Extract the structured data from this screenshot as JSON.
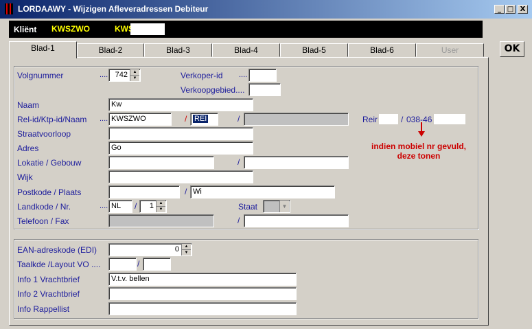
{
  "window": {
    "title": "LORDAAWY - Wijzigen Afleveradressen Debiteur",
    "minimize": "_",
    "maximize": "□",
    "close": "X"
  },
  "client": {
    "label": "Kliënt",
    "code": "KWSZWO",
    "name": "KWS"
  },
  "tabs": [
    "Blad-1",
    "Blad-2",
    "Blad-3",
    "Blad-4",
    "Blad-5",
    "Blad-6",
    "User"
  ],
  "ok_label": "OK",
  "form": {
    "volgnummer": {
      "label": "Volgnummer",
      "dots": "....",
      "value": "742"
    },
    "verkoper": {
      "label": "Verkoper-id",
      "dots": "....",
      "value": ""
    },
    "verkoopgebied": {
      "label": "Verkoopgebied....",
      "value": ""
    },
    "naam": {
      "label": "Naam",
      "value": "Kw"
    },
    "relid": {
      "label": "Rel-id/Ktp-id/Naam",
      "dots": "....",
      "rel": "KWSZWO",
      "slash1": "/",
      "ktp": "REI",
      "slash2": "/",
      "naam": ""
    },
    "side_contact": {
      "name": "Reir",
      "sep": "/",
      "phone": "038-46"
    },
    "straat": {
      "label": "Straatvoorloop",
      "value": ""
    },
    "adres": {
      "label": "Adres",
      "value": "Go"
    },
    "lokatie": {
      "label": "Lokatie / Gebouw",
      "value": "",
      "slash": "/",
      "value2": ""
    },
    "wijk": {
      "label": "Wijk",
      "value": ""
    },
    "postkode": {
      "label": "Postkode / Plaats",
      "value": "",
      "slash": "/",
      "plaats": "Wi"
    },
    "landkode": {
      "label": "Landkode  / Nr.",
      "dots": "....",
      "land": "NL",
      "slash": "/",
      "nr": "1"
    },
    "staat": {
      "label": "Staat",
      "value": ""
    },
    "telefoon": {
      "label": "Telefoon / Fax",
      "value": "",
      "slash": "/",
      "fax": ""
    },
    "note": [
      "indien mobiel nr gevuld,",
      "deze tonen"
    ]
  },
  "form2": {
    "ean": {
      "label": "EAN-adreskode (EDI)",
      "value": "0"
    },
    "taalkode": {
      "label": "Taalkde /Layout VO ....",
      "value": "",
      "slash": "/",
      "layout": ""
    },
    "info1": {
      "label": "Info 1 Vrachtbrief",
      "value": "V.t.v. bellen"
    },
    "info2": {
      "label": "Info 2 Vrachtbrief",
      "value": ""
    },
    "info_rappel": {
      "label": "Info Rappellist",
      "value": ""
    }
  }
}
